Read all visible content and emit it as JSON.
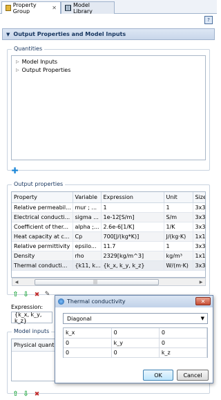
{
  "tabs": [
    {
      "label": "Property Group",
      "icon": "property-group-icon",
      "active": true
    },
    {
      "label": "Model Library",
      "icon": "model-library-icon",
      "active": false
    }
  ],
  "section": {
    "title": "Output Properties and Model Inputs"
  },
  "quantities": {
    "title": "Quantities",
    "items": [
      "Model Inputs",
      "Output Properties"
    ]
  },
  "output_properties": {
    "title": "Output properties",
    "columns": [
      "Property",
      "Variable",
      "Expression",
      "Unit",
      "Size"
    ],
    "rows": [
      [
        "Relative permeabil...",
        "mur ; ...",
        "1",
        "1",
        "3x3"
      ],
      [
        "Electrical conducti...",
        "sigma ...",
        "1e-12[S/m]",
        "S/m",
        "3x3"
      ],
      [
        "Coefficient of ther...",
        "alpha ;...",
        "2.6e-6[1/K]",
        "1/K",
        "3x3"
      ],
      [
        "Heat capacity at c...",
        "Cp",
        "700[J/(kg*K)]",
        "J/(kg·K)",
        "1x1"
      ],
      [
        "Relative permittivity",
        "epsilo...",
        "11.7",
        "1",
        "3x3"
      ],
      [
        "Density",
        "rho",
        "2329[kg/m^3]",
        "kg/m³",
        "1x1"
      ],
      [
        "Thermal conducti...",
        "{k11, k...",
        "{k_x, k_y, k_z}",
        "W/(m·K)",
        "3x3"
      ]
    ]
  },
  "expression": {
    "label": "Expression:",
    "value": "{k_x, k_y, k_z}"
  },
  "model_inputs": {
    "title": "Model inputs",
    "header": "Physical quantit"
  },
  "dialog": {
    "title": "Thermal conductivity",
    "mode": "Diagonal",
    "matrix": [
      [
        "k_x",
        "0",
        "0"
      ],
      [
        "0",
        "k_y",
        "0"
      ],
      [
        "0",
        "0",
        "k_z"
      ]
    ],
    "ok_label": "OK",
    "cancel_label": "Cancel"
  },
  "colors": {
    "header_text": "#15345e",
    "accent": "#1aa53a"
  }
}
